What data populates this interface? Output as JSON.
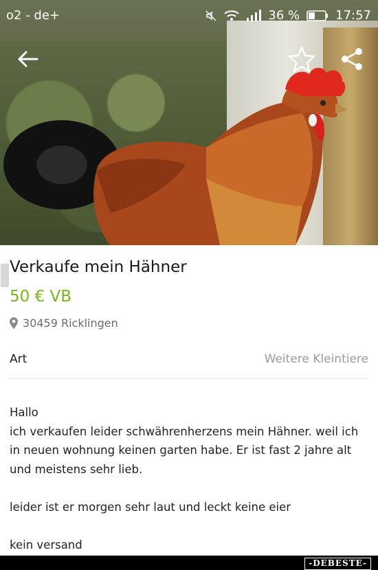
{
  "status_bar": {
    "carrier": "o2 - de+",
    "battery": "36 %",
    "time": "17:57"
  },
  "app_bar": {
    "back_icon": "arrow-left-icon",
    "favorite_icon": "star-outline-icon",
    "share_icon": "share-icon"
  },
  "listing": {
    "title": "Verkaufe mein Hähner",
    "price": "50 € VB",
    "location": "30459 Ricklingen",
    "attribute": {
      "label": "Art",
      "value": "Weitere Kleintiere"
    },
    "description": {
      "line1": "Hallo",
      "line2": "ich verkaufen leider schwährenherzens mein Hähner. weil ich in neuen wohnung keinen garten habe. Er ist fast 2 jahre alt und meistens sehr lieb.",
      "line3": "leider ist er morgen sehr laut und leckt keine eier",
      "line4": "kein versand"
    }
  },
  "watermark": "-DEBESTE-",
  "colors": {
    "price": "#7cb518",
    "text": "#1a1a1a",
    "muted": "#9a9a9a"
  }
}
